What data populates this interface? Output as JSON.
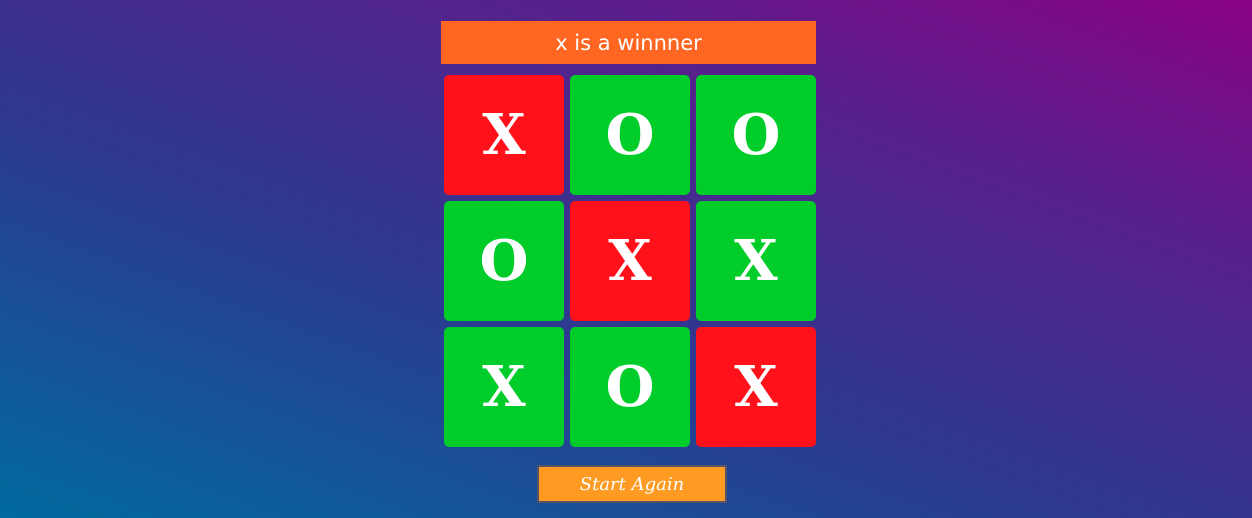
{
  "game": {
    "status_text": "x is a winnner",
    "start_again_label": "Start Again",
    "board": [
      {
        "mark": "X",
        "color": "#ff111b"
      },
      {
        "mark": "O",
        "color": "#00cc2a"
      },
      {
        "mark": "O",
        "color": "#00cc2a"
      },
      {
        "mark": "O",
        "color": "#00cc2a"
      },
      {
        "mark": "X",
        "color": "#ff111b"
      },
      {
        "mark": "X",
        "color": "#00cc2a"
      },
      {
        "mark": "X",
        "color": "#00cc2a"
      },
      {
        "mark": "O",
        "color": "#00cc2a"
      },
      {
        "mark": "X",
        "color": "#ff111b"
      }
    ]
  },
  "colors": {
    "status_bg": "#ff6622",
    "winning_cell": "#ff111b",
    "normal_cell": "#00cc2a",
    "button_bg": "#ff9a22"
  }
}
